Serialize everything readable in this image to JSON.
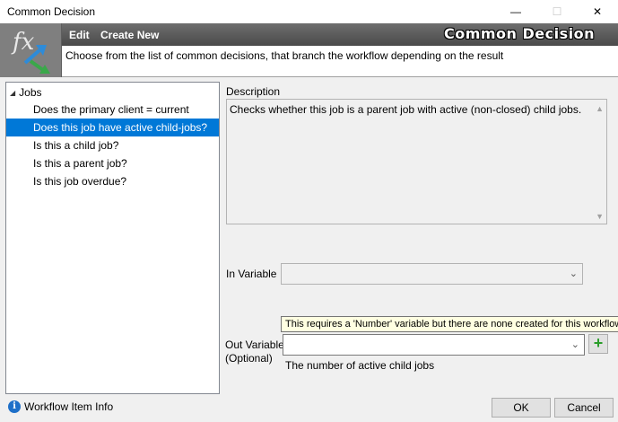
{
  "window": {
    "title": "Common Decision",
    "minimize_glyph": "—",
    "maximize_glyph": "☐",
    "close_glyph": "✕"
  },
  "header": {
    "icon_text": "fx",
    "menu": {
      "edit": "Edit",
      "create_new": "Create New"
    },
    "title": "Common Decision",
    "subtitle": "Choose from the list of common decisions, that branch the workflow depending on the result"
  },
  "tree": {
    "root_label": "Jobs",
    "root_arrow": "◢",
    "items": [
      "Does the primary client = current user?",
      "Does this job have active child-jobs?",
      "Is this a child job?",
      "Is this a parent job?",
      "Is this job overdue?"
    ],
    "selected_index": 1
  },
  "description": {
    "label": "Description",
    "text": "Checks whether this job is a parent job with active (non-closed) child jobs.",
    "scroll_up": "▲",
    "scroll_down": "▼"
  },
  "in_variable": {
    "label": "In Variable",
    "value": "",
    "chevron": "⌄"
  },
  "out_variable": {
    "label_line1": "Out Variable",
    "label_line2": "(Optional)",
    "value": "",
    "chevron": "⌄",
    "tooltip": "This requires a 'Number' variable but there are none created for this workflow",
    "hint": "The number of active child jobs",
    "add_glyph": "+"
  },
  "footer": {
    "info_glyph": "i",
    "info_label": "Workflow Item Info",
    "ok_label": "OK",
    "cancel_label": "Cancel"
  },
  "colors": {
    "selection": "#0078d7",
    "header_bar": "#5a5a5a",
    "add_icon": "#2a9d2a",
    "info_icon": "#1e6fc8"
  }
}
